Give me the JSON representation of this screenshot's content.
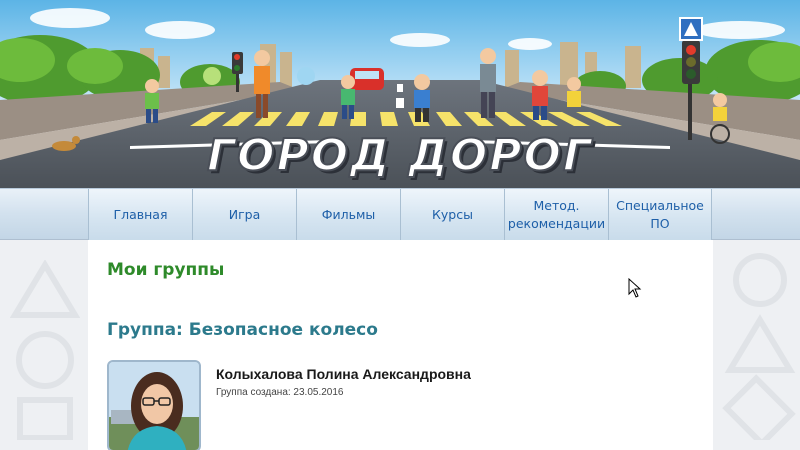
{
  "banner": {
    "title": "ГОРОД ДОРОГ"
  },
  "nav": {
    "items": [
      {
        "label": "Главная"
      },
      {
        "label": "Игра"
      },
      {
        "label": "Фильмы"
      },
      {
        "label": "Курсы"
      },
      {
        "label": "Метод. рекомендации"
      },
      {
        "label": "Специальное ПО"
      }
    ]
  },
  "page": {
    "heading": "Мои группы",
    "group_title": "Группа: Безопасное колесо",
    "member": {
      "name": "Колыхалова Полина Александровна",
      "created": "Группа создана: 23.05.2016"
    }
  },
  "colors": {
    "heading_green": "#2e8a2a",
    "group_teal": "#2c7a8c",
    "nav_text": "#1e5fa8"
  }
}
